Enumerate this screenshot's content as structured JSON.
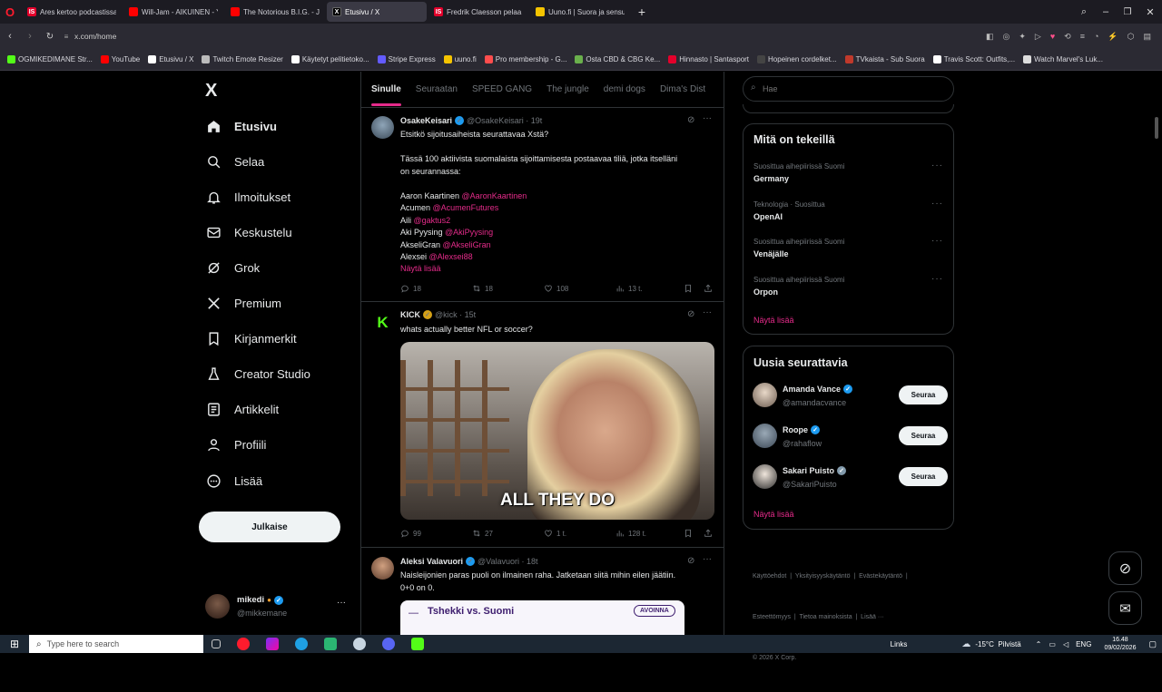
{
  "browser": {
    "tabs": [
      {
        "label": "Ares kertoo podcastissa va",
        "fav": "IS",
        "color": "#e4002b"
      },
      {
        "label": "Will-Jam - AIKUINEN - Yo",
        "fav": "",
        "color": "#ff0000"
      },
      {
        "label": "The Notorious B.I.G. - Juic",
        "fav": "",
        "color": "#ff0000"
      },
      {
        "label": "Etusivu / X",
        "fav": "X",
        "color": "#000000",
        "active": true
      },
      {
        "label": "Fredrik Claesson pelaa Ve",
        "fav": "IS",
        "color": "#e4002b"
      },
      {
        "label": "Uuno.fi | Suora ja sensuro",
        "fav": "",
        "color": "#f5c400"
      }
    ],
    "url": "x.com/home",
    "bookmarks": [
      {
        "label": "OGMIKEDIMANE Str...",
        "color": "#53fc18"
      },
      {
        "label": "YouTube",
        "color": "#ff0000"
      },
      {
        "label": "Etusivu / X",
        "color": "#ffffff"
      },
      {
        "label": "Twitch Emote Resizer",
        "color": "#bbbbbb"
      },
      {
        "label": "Käytetyt pelitietoko...",
        "color": "#ffffff"
      },
      {
        "label": "Stripe Express",
        "color": "#635bff"
      },
      {
        "label": "uuno.fi",
        "color": "#f5c400"
      },
      {
        "label": "Pro membership - G...",
        "color": "#ff4d4d"
      },
      {
        "label": "Osta CBD & CBG Ke...",
        "color": "#6ab04c"
      },
      {
        "label": "Hinnasto | Santasport",
        "color": "#e4002b"
      },
      {
        "label": "Hopeinen cordelket...",
        "color": "#444444"
      },
      {
        "label": "TVkaista - Sub Suora",
        "color": "#c0392b"
      },
      {
        "label": "Travis Scott: Outfits,...",
        "color": "#ffffff"
      },
      {
        "label": "Watch Marvel's Luk...",
        "color": "#dddddd"
      }
    ]
  },
  "sidebar": {
    "logo": "X",
    "items": [
      {
        "label": "Etusivu",
        "icon": "home-icon"
      },
      {
        "label": "Selaa",
        "icon": "search-icon"
      },
      {
        "label": "Ilmoitukset",
        "icon": "bell-icon"
      },
      {
        "label": "Keskustelu",
        "icon": "mail-icon"
      },
      {
        "label": "Grok",
        "icon": "grok-icon"
      },
      {
        "label": "Premium",
        "icon": "x-icon"
      },
      {
        "label": "Kirjanmerkit",
        "icon": "bookmark-icon"
      },
      {
        "label": "Creator Studio",
        "icon": "flask-icon"
      },
      {
        "label": "Artikkelit",
        "icon": "article-icon"
      },
      {
        "label": "Profiili",
        "icon": "person-icon"
      },
      {
        "label": "Lisää",
        "icon": "more-icon"
      }
    ],
    "post_button": "Julkaise",
    "account": {
      "name": "mikedi",
      "handle": "@mikkemane"
    }
  },
  "feed": {
    "tabs": [
      "Sinulle",
      "Seuraatan",
      "SPEED GANG",
      "The jungle",
      "demi dogs",
      "Dima's Dist"
    ],
    "tweets": [
      {
        "name": "OsakeKeisari",
        "handle": "@OsakeKeisari · 19t",
        "lines": [
          {
            "t": "Etsitkö sijoitusaiheista seurattavaa Xstä?"
          },
          {
            "t": ""
          },
          {
            "t": "Tässä 100 aktiivista suomalaista sijoittamisesta postaavaa tiliä, jotka itselläni"
          },
          {
            "t": "on seurannassa:"
          },
          {
            "t": ""
          },
          {
            "t": "Aaron Kaartinen ",
            "m": "@AaronKaartinen"
          },
          {
            "t": "Acumen ",
            "m": "@AcumenFutures"
          },
          {
            "t": "Aili ",
            "m": "@gaktus2"
          },
          {
            "t": "Aki Pyysing ",
            "m": "@AkiPyysing"
          },
          {
            "t": "AkseliGran ",
            "m": "@AkseliGran"
          },
          {
            "t": "Alexsei ",
            "m": "@Alexsei88"
          }
        ],
        "show_more": "Näytä lisää",
        "replies": "18",
        "reposts": "18",
        "likes": "108",
        "views": "13 t."
      },
      {
        "name": "KICK",
        "handle": "@kick · 15t",
        "text": "whats actually better NFL or soccer?",
        "caption": "ALL THEY DO",
        "replies": "99",
        "reposts": "27",
        "likes": "1 t.",
        "views": "128 t."
      },
      {
        "name": "Aleksi Valavuori",
        "handle": "@Valavuori · 18t",
        "lines": [
          {
            "t": "Naisleijonien paras puoli on ilmainen raha. Jatketaan siitä mihin eilen jäätiin."
          },
          {
            "t": "0+0 on 0."
          }
        ],
        "card_title": "Tshekki vs. Suomi",
        "card_badge": "AVOINNA"
      }
    ]
  },
  "right": {
    "search_placeholder": "Hae",
    "trending_title": "Mitä on tekeillä",
    "trends": [
      {
        "context": "Suosittua aihepiirissä Suomi",
        "name": "Germany"
      },
      {
        "context": "Teknologia · Suosittua",
        "name": "OpenAI"
      },
      {
        "context": "Suosittua aihepiirissä Suomi",
        "name": "Venäjälle"
      },
      {
        "context": "Suosittua aihepiirissä Suomi",
        "name": "Orpon"
      }
    ],
    "trends_more": "Näytä lisää",
    "who_title": "Uusia seurattavia",
    "who": [
      {
        "name": "Amanda Vance",
        "handle": "@amandacvance",
        "badge": "blue"
      },
      {
        "name": "Roope",
        "handle": "@rahaflow",
        "badge": "blue"
      },
      {
        "name": "Sakari Puisto",
        "handle": "@SakariPuisto",
        "badge": "grey"
      }
    ],
    "follow_label": "Seuraa",
    "who_more": "Näytä lisää",
    "footer1": "Käyttöehdot  |  Yksityisyyskäytäntö  |  Evästekäytäntö  |",
    "footer2": "Esteettömyys  |  Tietoa mainoksista  |  Lisää ···",
    "footer3": "© 2026 X Corp."
  },
  "taskbar": {
    "search_placeholder": "Type here to search",
    "links": "Links",
    "weather": "-15°C  Pilvistä",
    "lang": "ENG",
    "time": "16.48",
    "date": "09/02/2026"
  }
}
